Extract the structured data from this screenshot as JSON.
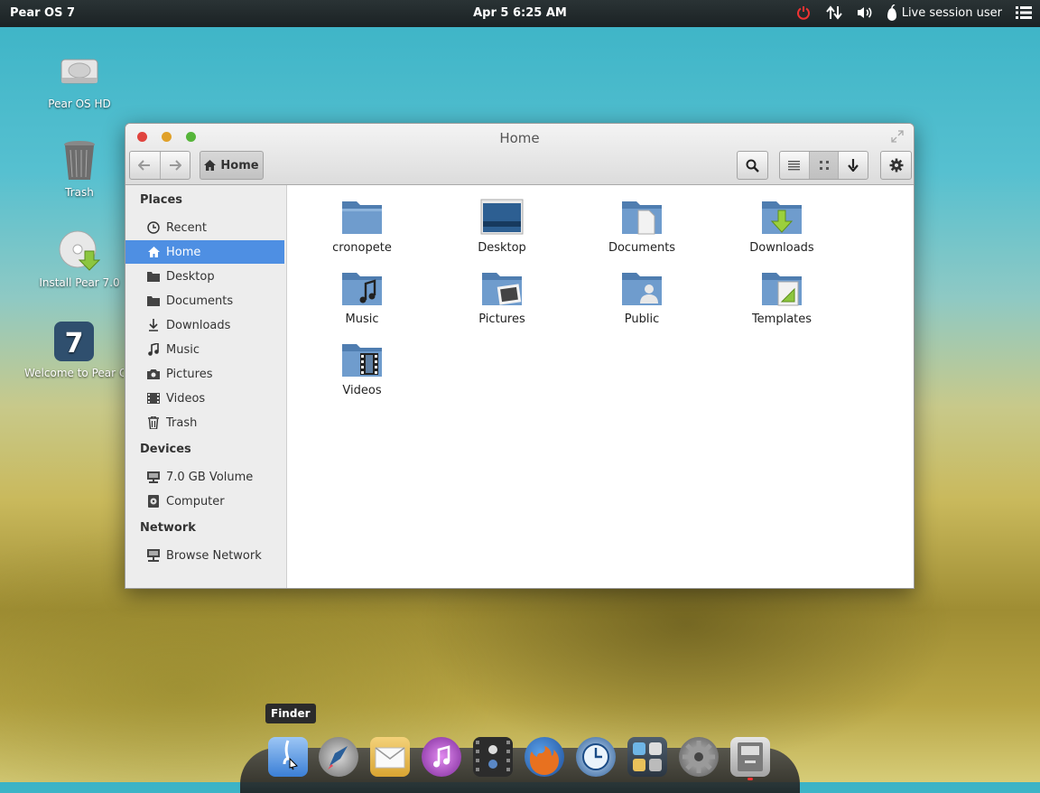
{
  "panel": {
    "os_name": "Pear OS 7",
    "clock": "Apr  5   6:25 AM",
    "user": "Live session user"
  },
  "desktop_icons": [
    {
      "label": "Pear OS HD"
    },
    {
      "label": "Trash"
    },
    {
      "label": "Install Pear 7.0"
    },
    {
      "label": "Welcome to Pear O"
    }
  ],
  "window": {
    "title": "Home",
    "path_button": "Home"
  },
  "sidebar": {
    "places_header": "Places",
    "places": [
      {
        "label": "Recent",
        "icon": "clock-icon"
      },
      {
        "label": "Home",
        "icon": "home-icon"
      },
      {
        "label": "Desktop",
        "icon": "folder-icon"
      },
      {
        "label": "Documents",
        "icon": "folder-icon"
      },
      {
        "label": "Downloads",
        "icon": "download-icon"
      },
      {
        "label": "Music",
        "icon": "music-note-icon"
      },
      {
        "label": "Pictures",
        "icon": "camera-icon"
      },
      {
        "label": "Videos",
        "icon": "film-icon"
      },
      {
        "label": "Trash",
        "icon": "trash-icon"
      }
    ],
    "devices_header": "Devices",
    "devices": [
      {
        "label": "7.0 GB Volume",
        "icon": "drive-icon"
      },
      {
        "label": "Computer",
        "icon": "computer-icon"
      }
    ],
    "network_header": "Network",
    "network": [
      {
        "label": "Browse Network",
        "icon": "network-icon"
      }
    ]
  },
  "folders": [
    {
      "label": "cronopete"
    },
    {
      "label": "Desktop"
    },
    {
      "label": "Documents"
    },
    {
      "label": "Downloads"
    },
    {
      "label": "Music"
    },
    {
      "label": "Pictures"
    },
    {
      "label": "Public"
    },
    {
      "label": "Templates"
    },
    {
      "label": "Videos"
    }
  ],
  "dock": {
    "tooltip": "Finder",
    "items": [
      "finder-icon",
      "launchpad-icon",
      "mail-icon",
      "music-player-icon",
      "video-icon",
      "firefox-icon",
      "time-machine-icon",
      "app-store-icon",
      "settings-icon",
      "file-manager-icon"
    ]
  },
  "colors": {
    "accent": "#4e8fe3",
    "panel": "#1b2224",
    "close": "#e0443e",
    "minimize": "#e0a12a",
    "maximize": "#56b53a"
  }
}
